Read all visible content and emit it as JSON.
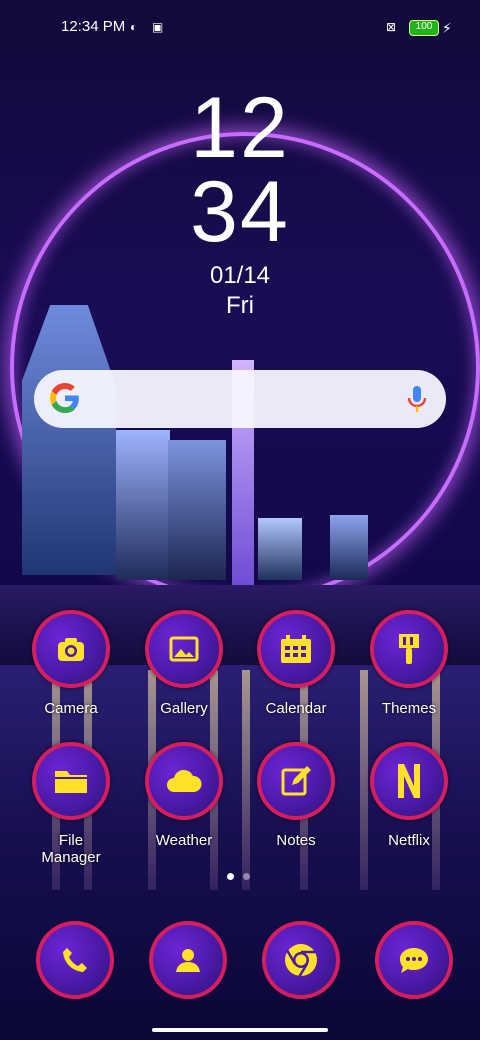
{
  "status": {
    "time": "12:34 PM",
    "battery": "100"
  },
  "clock": {
    "hours": "12",
    "minutes": "34",
    "date": "01/14",
    "day": "Fri"
  },
  "apps_row1": [
    {
      "label": "Camera"
    },
    {
      "label": "Gallery"
    },
    {
      "label": "Calendar"
    },
    {
      "label": "Themes"
    }
  ],
  "apps_row2": [
    {
      "label": "File Manager"
    },
    {
      "label": "Weather"
    },
    {
      "label": "Notes"
    },
    {
      "label": "Netflix"
    }
  ],
  "icons": {
    "camera": "camera-icon",
    "gallery": "image-icon",
    "calendar": "calendar-icon",
    "themes": "paintbrush-icon",
    "file_manager": "folder-icon",
    "weather": "cloud-icon",
    "notes": "note-edit-icon",
    "netflix": "netflix-n-icon",
    "phone": "phone-icon",
    "contacts": "person-icon",
    "chrome": "chrome-icon",
    "messages": "message-icon"
  },
  "colors": {
    "accent": "#ffe227",
    "ring": "#d81d5f",
    "icon_bg": "#4b1aa8"
  }
}
